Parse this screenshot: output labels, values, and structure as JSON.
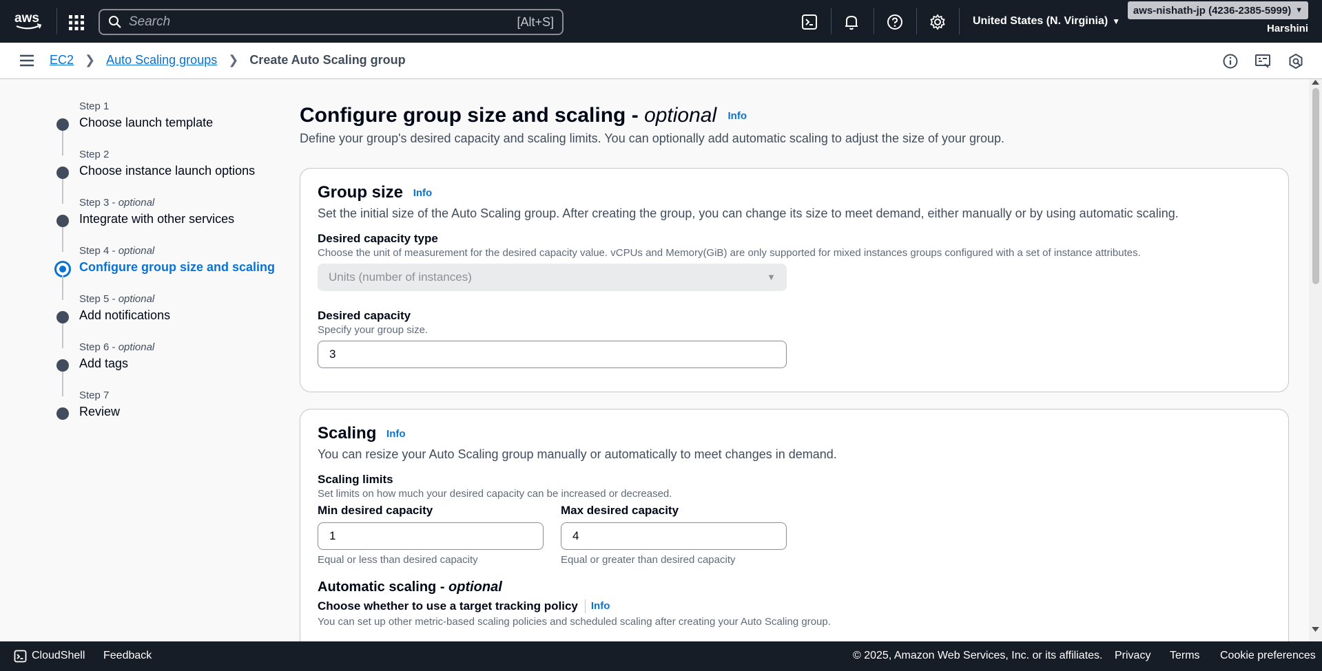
{
  "topnav": {
    "search_placeholder": "Search",
    "search_shortcut": "[Alt+S]",
    "region": "United States (N. Virginia)",
    "account": "aws-nishath-jp (4236-2385-5999)",
    "user": "Harshini"
  },
  "breadcrumb": {
    "items": [
      "EC2",
      "Auto Scaling groups"
    ],
    "current": "Create Auto Scaling group"
  },
  "steps": [
    {
      "label": "Step 1",
      "optional": "",
      "title": "Choose launch template"
    },
    {
      "label": "Step 2",
      "optional": "",
      "title": "Choose instance launch options"
    },
    {
      "label": "Step 3",
      "optional": "optional",
      "title": "Integrate with other services"
    },
    {
      "label": "Step 4",
      "optional": "optional",
      "title": "Configure group size and scaling"
    },
    {
      "label": "Step 5",
      "optional": "optional",
      "title": "Add notifications"
    },
    {
      "label": "Step 6",
      "optional": "optional",
      "title": "Add tags"
    },
    {
      "label": "Step 7",
      "optional": "",
      "title": "Review"
    }
  ],
  "page": {
    "title": "Configure group size and scaling",
    "title_suffix": "optional",
    "info": "Info",
    "description": "Define your group's desired capacity and scaling limits. You can optionally add automatic scaling to adjust the size of your group."
  },
  "group_size": {
    "title": "Group size",
    "info": "Info",
    "description": "Set the initial size of the Auto Scaling group. After creating the group, you can change its size to meet demand, either manually or by using automatic scaling.",
    "capacity_type_label": "Desired capacity type",
    "capacity_type_desc": "Choose the unit of measurement for the desired capacity value. vCPUs and Memory(GiB) are only supported for mixed instances groups configured with a set of instance attributes.",
    "capacity_type_value": "Units (number of instances)",
    "desired_label": "Desired capacity",
    "desired_desc": "Specify your group size.",
    "desired_value": "3"
  },
  "scaling": {
    "title": "Scaling",
    "info": "Info",
    "description": "You can resize your Auto Scaling group manually or automatically to meet changes in demand.",
    "limits_label": "Scaling limits",
    "limits_desc": "Set limits on how much your desired capacity can be increased or decreased.",
    "min_label": "Min desired capacity",
    "min_value": "1",
    "min_constraint": "Equal or less than desired capacity",
    "max_label": "Max desired capacity",
    "max_value": "4",
    "max_constraint": "Equal or greater than desired capacity",
    "auto_label": "Automatic scaling - ",
    "auto_suffix": "optional",
    "policy_label": "Choose whether to use a target tracking policy",
    "policy_info": "Info",
    "policy_desc": "You can set up other metric-based scaling policies and scheduled scaling after creating your Auto Scaling group."
  },
  "footer": {
    "cloudshell": "CloudShell",
    "feedback": "Feedback",
    "copyright": "© 2025, Amazon Web Services, Inc. or its affiliates.",
    "privacy": "Privacy",
    "terms": "Terms",
    "cookies": "Cookie preferences"
  }
}
